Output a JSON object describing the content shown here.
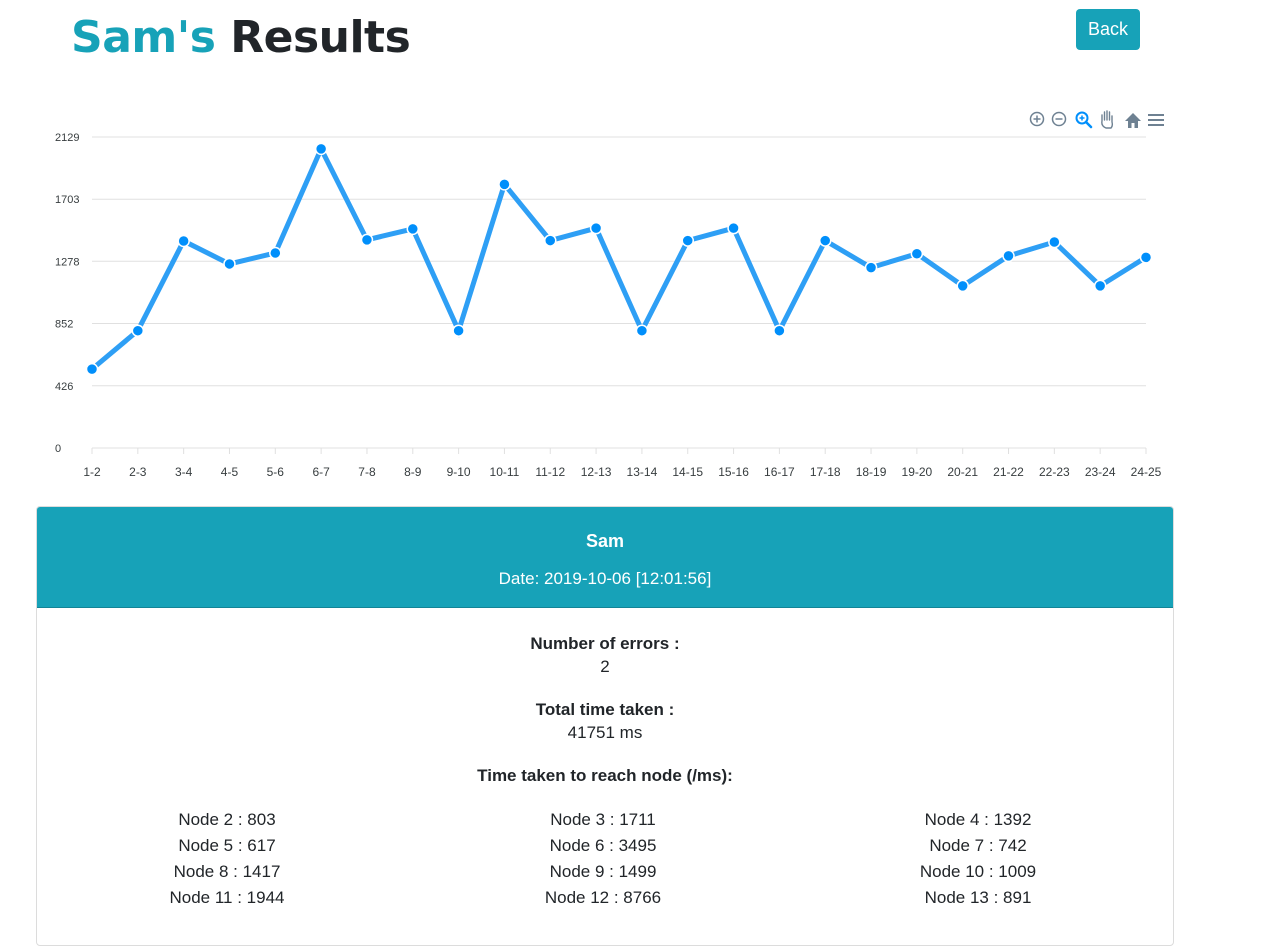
{
  "header": {
    "name_part": "Sam's",
    "title_part": "Results",
    "back_label": "Back"
  },
  "toolbar": {
    "icons": [
      "zoom-in-icon",
      "zoom-out-icon",
      "selection-zoom-icon",
      "pan-icon",
      "reset-home-icon",
      "menu-icon"
    ],
    "active_color": "#008ffb",
    "inactive_color": "#6e8192"
  },
  "chart_data": {
    "type": "line",
    "categories": [
      "1-2",
      "2-3",
      "3-4",
      "4-5",
      "5-6",
      "6-7",
      "7-8",
      "8-9",
      "9-10",
      "10-11",
      "11-12",
      "12-13",
      "13-14",
      "14-15",
      "15-16",
      "16-17",
      "17-18",
      "18-19",
      "19-20",
      "20-21",
      "21-22",
      "22-23",
      "23-24",
      "24-25"
    ],
    "series": [
      {
        "values": [
          540,
          803,
          1417,
          1260,
          1335,
          2048,
          1425,
          1500,
          803,
          1805,
          1420,
          1505,
          803,
          1420,
          1505,
          803,
          1420,
          1235,
          1330,
          1110,
          1315,
          1410,
          1110,
          1305
        ]
      }
    ],
    "yticks": [
      0,
      426,
      852,
      1278,
      1703,
      2129
    ],
    "ylim": [
      0,
      2129
    ],
    "grid": true,
    "line_color": "#2e9ff5",
    "marker_color": "#008ffb"
  },
  "result_card": {
    "user": "Sam",
    "date": "Date: 2019-10-06 [12:01:56]",
    "errors_label": "Number of errors :",
    "errors_value": "2",
    "time_label": "Total time taken :",
    "time_value": "41751 ms",
    "nodes_label": "Time taken to reach node (/ms):",
    "nodes": [
      "Node 2 : 803",
      "Node 3 : 1711",
      "Node 4 : 1392",
      "Node 5 : 617",
      "Node 6 : 3495",
      "Node 7 : 742",
      "Node 8 : 1417",
      "Node 9 : 1499",
      "Node 10 : 1009",
      "Node 11 : 1944",
      "Node 12 : 8766",
      "Node 13 : 891"
    ],
    "header_color": "#17a2b8"
  }
}
